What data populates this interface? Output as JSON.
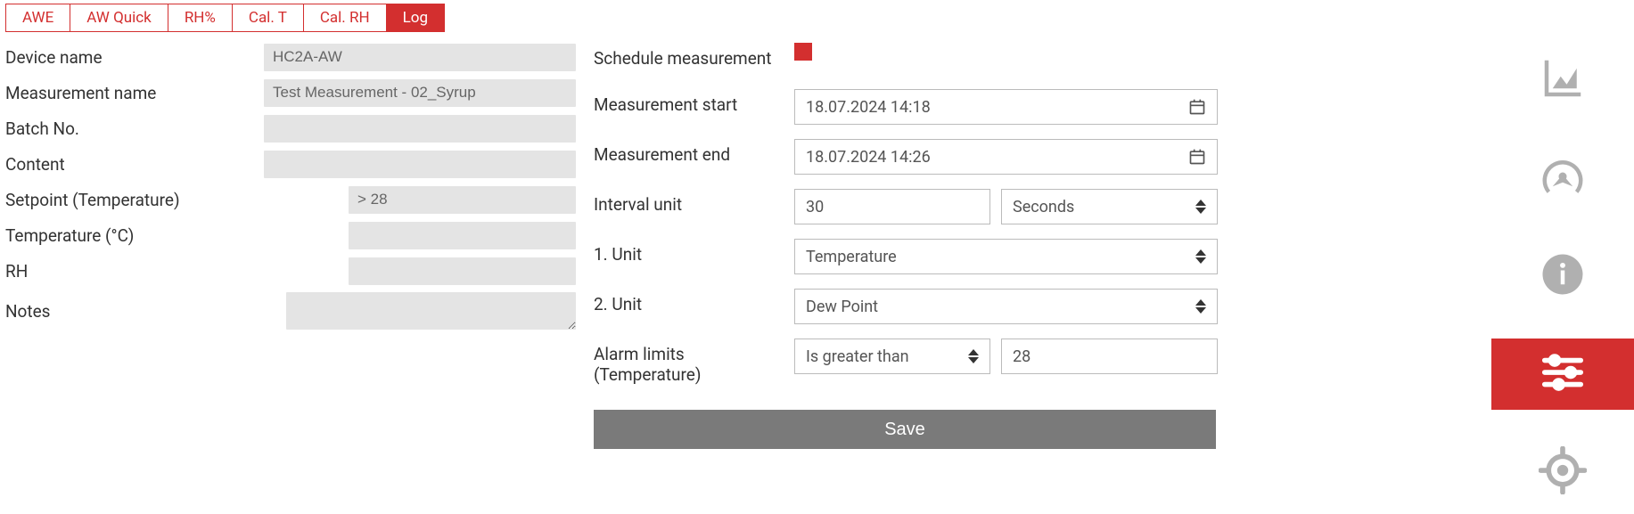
{
  "tabs": [
    {
      "label": "AWE"
    },
    {
      "label": "AW Quick"
    },
    {
      "label": "RH%"
    },
    {
      "label": "Cal. T"
    },
    {
      "label": "Cal. RH"
    },
    {
      "label": "Log"
    }
  ],
  "active_tab": 5,
  "left": {
    "device_name_label": "Device name",
    "device_name_value": "HC2A-AW",
    "measurement_name_label": "Measurement name",
    "measurement_name_value": "Test Measurement - 02_Syrup",
    "batch_no_label": "Batch No.",
    "batch_no_value": "",
    "content_label": "Content",
    "content_value": "",
    "setpoint_label": "Setpoint (Temperature)",
    "setpoint_value": "> 28",
    "temperature_label": "Temperature (°C)",
    "temperature_value": "",
    "rh_label": "RH",
    "rh_value": "",
    "notes_label": "Notes",
    "notes_value": ""
  },
  "right": {
    "schedule_label": "Schedule measurement",
    "schedule_checked": true,
    "measurement_start_label": "Measurement start",
    "measurement_start_value": "18.07.2024 14:18",
    "measurement_end_label": "Measurement end",
    "measurement_end_value": "18.07.2024 14:26",
    "interval_unit_label": "Interval unit",
    "interval_value": "30",
    "interval_unit_value": "Seconds",
    "unit1_label": "1. Unit",
    "unit1_value": "Temperature",
    "unit2_label": "2. Unit",
    "unit2_value": "Dew Point",
    "alarm_limits_label": "Alarm limits (Temperature)",
    "alarm_op_value": "Is greater than",
    "alarm_threshold_value": "28",
    "save_label": "Save"
  },
  "sidebar": {
    "items": [
      {
        "name": "chart-icon"
      },
      {
        "name": "gauge-icon"
      },
      {
        "name": "info-icon"
      },
      {
        "name": "sliders-icon"
      },
      {
        "name": "target-icon"
      }
    ],
    "active": 3
  }
}
